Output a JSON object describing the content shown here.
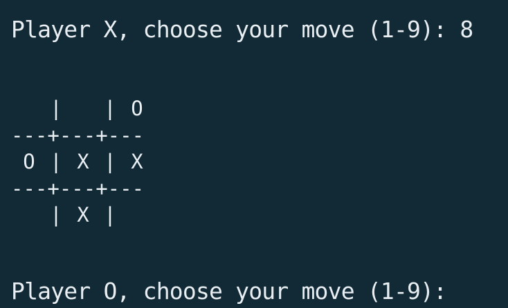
{
  "terminal": {
    "prompt_x": "Player X, choose your move (1-9): ",
    "input_x": "8",
    "prompt_o": "Player O, choose your move (1-9): "
  },
  "board": {
    "rows": [
      [
        "",
        "",
        "O"
      ],
      [
        "O",
        "X",
        "X"
      ],
      [
        "",
        "X",
        ""
      ]
    ],
    "separator": "|",
    "divider": "---+---+---"
  }
}
